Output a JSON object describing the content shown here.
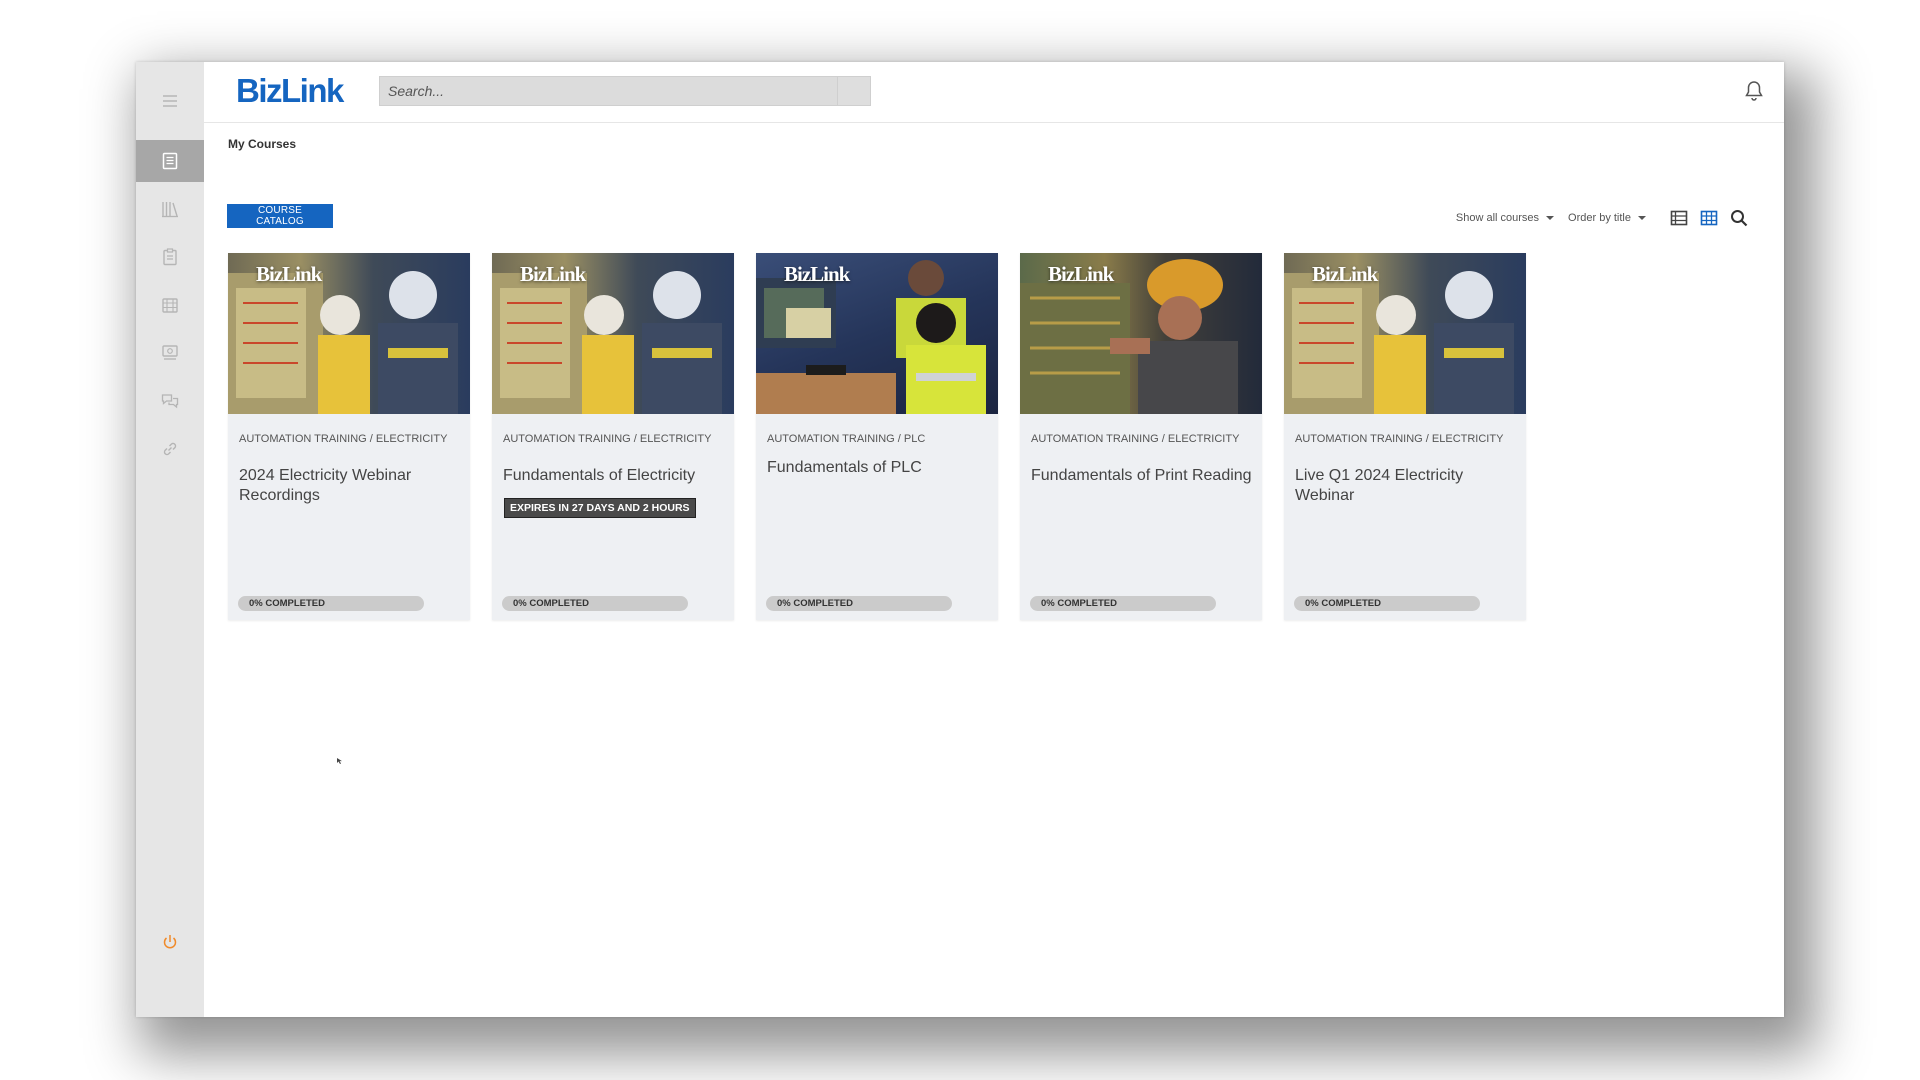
{
  "app": {
    "brand": "BizLink"
  },
  "search": {
    "placeholder": "Search..."
  },
  "page": {
    "title": "My Courses"
  },
  "toolbar": {
    "catalog_label": "COURSE CATALOG",
    "filter_label": "Show all courses",
    "order_label": "Order by title"
  },
  "sidebar": {
    "items": [
      {
        "icon": "menu-icon"
      },
      {
        "icon": "course-book-icon"
      },
      {
        "icon": "library-icon"
      },
      {
        "icon": "clipboard-icon"
      },
      {
        "icon": "calendar-icon"
      },
      {
        "icon": "certificate-icon"
      },
      {
        "icon": "chat-icon"
      },
      {
        "icon": "link-icon"
      },
      {
        "icon": "power-icon"
      }
    ]
  },
  "colors": {
    "accent": "#1565c0",
    "sidebar": "#e6e6e6",
    "sidebar_active": "#a7a7a7",
    "power": "#f08a2a"
  },
  "courses": [
    {
      "logo": "BizLink",
      "category": "AUTOMATION TRAINING / ELECTRICITY",
      "title": "2024 Electricity Webinar Recordings",
      "badge": "",
      "progress": 0,
      "progress_label": "0% COMPLETED"
    },
    {
      "logo": "BizLink",
      "category": "AUTOMATION TRAINING / ELECTRICITY",
      "title": "Fundamentals of Electricity",
      "badge": "EXPIRES IN 27 DAYS AND 2 HOURS",
      "progress": 0,
      "progress_label": "0% COMPLETED"
    },
    {
      "logo": "BizLink",
      "category": "AUTOMATION TRAINING / PLC",
      "title": "Fundamentals of PLC",
      "badge": "",
      "progress": 0,
      "progress_label": "0% COMPLETED"
    },
    {
      "logo": "BizLink",
      "category": "AUTOMATION TRAINING / ELECTRICITY",
      "title": "Fundamentals of Print Reading",
      "badge": "",
      "progress": 0,
      "progress_label": "0% COMPLETED"
    },
    {
      "logo": "BizLink",
      "category": "AUTOMATION TRAINING / ELECTRICITY",
      "title": "Live Q1 2024 Electricity Webinar",
      "badge": "",
      "progress": 0,
      "progress_label": "0% COMPLETED"
    }
  ]
}
